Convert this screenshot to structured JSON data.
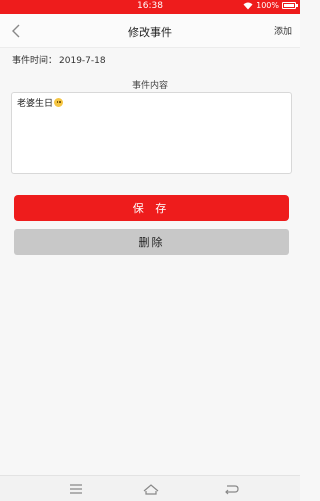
{
  "status_bar": {
    "time": "16:38",
    "battery": "100%"
  },
  "nav": {
    "title": "修改事件",
    "add_label": "添加"
  },
  "event": {
    "time_label": "事件时间：",
    "time_value": "2019-7-18",
    "content_title": "事件内容",
    "content_text": "老婆生日"
  },
  "buttons": {
    "save_label": "保 存",
    "delete_label": "删除"
  },
  "colors": {
    "accent": "#ee1c1c",
    "delete_bg": "#c8c8c8"
  }
}
